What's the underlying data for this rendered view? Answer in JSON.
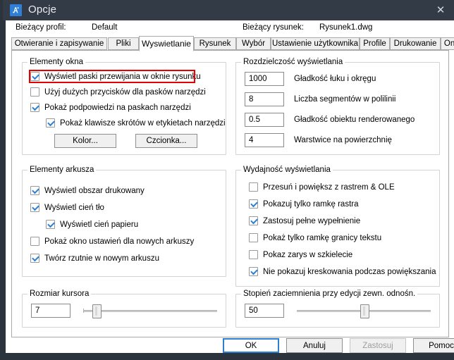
{
  "window": {
    "title": "Opcje",
    "icon": "cad-app-icon",
    "close_label": "✕",
    "titlebar_color": "#333b47",
    "accent_color": "#2a7fd4",
    "highlight_color": "#e60000"
  },
  "header": {
    "profile_label": "Bieżący profil:",
    "profile_value": "Default",
    "drawing_label": "Bieżący rysunek:",
    "drawing_value": "Rysunek1.dwg"
  },
  "tabs": [
    {
      "label": "Otwieranie i zapisywanie",
      "active": false
    },
    {
      "label": "Pliki",
      "active": false
    },
    {
      "label": "Wyswietlanie",
      "active": true
    },
    {
      "label": "Rysunek",
      "active": false
    },
    {
      "label": "Wybór",
      "active": false
    },
    {
      "label": "Ustawienie użytkownika",
      "active": false
    },
    {
      "label": "Profile",
      "active": false
    },
    {
      "label": "Drukowanie",
      "active": false
    },
    {
      "label": "Online",
      "active": false
    }
  ],
  "groups": {
    "window_elements": {
      "legend": "Elementy okna",
      "checkboxes": [
        {
          "label": "Wyświetl paski przewijania w oknie rysunku",
          "checked": true,
          "highlighted": true
        },
        {
          "label": "Użyj dużych przycisków dla pasków narzędzi",
          "checked": false,
          "highlighted": false
        },
        {
          "label": "Pokaż podpowiedzi na paskach narzędzi",
          "checked": true,
          "highlighted": false
        },
        {
          "label": "Pokaż klawisze skrótów w etykietach narzędzi",
          "checked": true,
          "highlighted": false,
          "indented": true
        }
      ],
      "buttons": [
        {
          "label": "Kolor...",
          "name": "color-button"
        },
        {
          "label": "Czcionka...",
          "name": "font-button"
        }
      ]
    },
    "display_resolution": {
      "legend": "Rozdzielczość wyświetlania",
      "fields": [
        {
          "value": "1000",
          "label": "Gładkość łuku i okręgu",
          "name": "arc-circle-smoothness"
        },
        {
          "value": "8",
          "label": "Liczba segmentów w polilinii",
          "name": "polyline-segments"
        },
        {
          "value": "0.5",
          "label": "Gładkość obiektu renderowanego",
          "name": "rendered-object-smoothness"
        },
        {
          "value": "4",
          "label": "Warstwice na powierzchnię",
          "name": "surface-contour-lines"
        }
      ]
    },
    "layout_elements": {
      "legend": "Elementy arkusza",
      "checkboxes": [
        {
          "label": "Wyświetl obszar drukowany",
          "checked": true
        },
        {
          "label": "Wyświetl cień tło",
          "checked": true
        },
        {
          "label": "Wyświetl cień papieru",
          "checked": true,
          "indented": true
        },
        {
          "label": "Pokaż okno ustawień dla nowych arkuszy",
          "checked": false
        },
        {
          "label": "Twórz rzutnie w nowym arkuszu",
          "checked": true
        }
      ]
    },
    "display_performance": {
      "legend": "Wydajność wyświetlania",
      "checkboxes": [
        {
          "label": "Przesuń i powiększ z rastrem & OLE",
          "checked": false
        },
        {
          "label": "Pokazuj tylko ramkę rastra",
          "checked": true
        },
        {
          "label": "Zastosuj pełne wypełnienie",
          "checked": true
        },
        {
          "label": "Pokaż tylko ramkę granicy tekstu",
          "checked": false
        },
        {
          "label": "Pokaz zarys w szkielecie",
          "checked": false
        },
        {
          "label": "Nie pokazuj kreskowania podczas powiększania",
          "checked": true
        }
      ]
    },
    "crosshair_size": {
      "legend": "Rozmiar kursora",
      "value": "7",
      "slider_percent": 7
    },
    "fade_control": {
      "legend": "Stopień zaciemnienia przy edycji zewn. odnośn.",
      "value": "50",
      "slider_percent": 50
    }
  },
  "footer": {
    "buttons": [
      {
        "label": "OK",
        "name": "ok-button",
        "style": "default",
        "disabled": false
      },
      {
        "label": "Anuluj",
        "name": "cancel-button",
        "style": "normal",
        "disabled": false
      },
      {
        "label": "Zastosuj",
        "name": "apply-button",
        "style": "normal",
        "disabled": true
      },
      {
        "label": "Pomoc",
        "name": "help-button",
        "style": "normal",
        "disabled": false
      }
    ]
  }
}
